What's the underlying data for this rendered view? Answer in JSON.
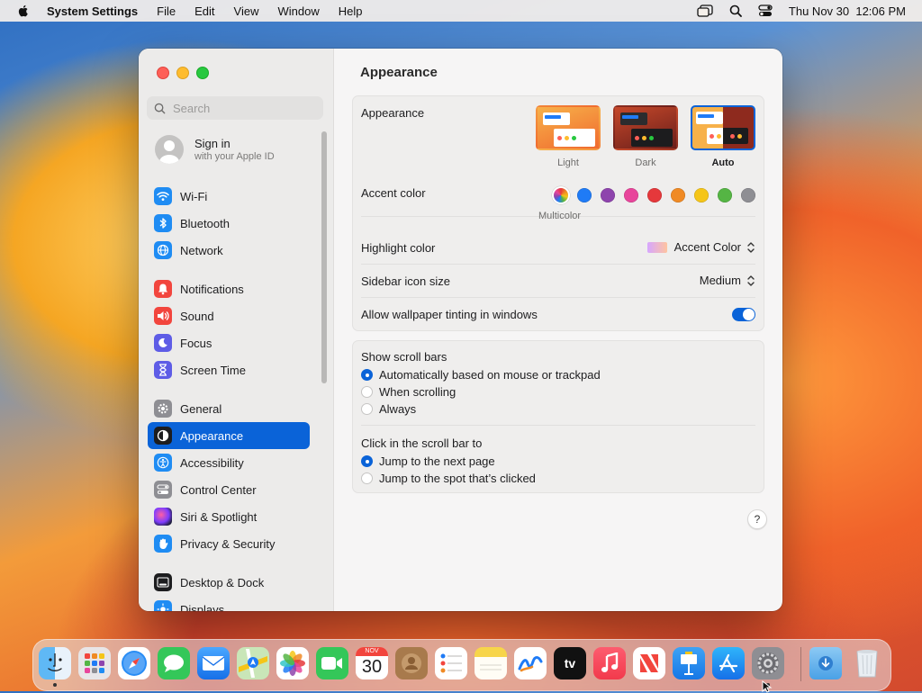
{
  "menubar": {
    "app_name": "System Settings",
    "menus": [
      "File",
      "Edit",
      "View",
      "Window",
      "Help"
    ],
    "clock": "Thu Nov 30  12:06 PM"
  },
  "sidebar": {
    "search_placeholder": "Search",
    "account": {
      "title": "Sign in",
      "subtitle": "with your Apple ID"
    },
    "items": [
      {
        "label": "Wi-Fi",
        "icon": "wifi-icon",
        "color": "#1f8cf3"
      },
      {
        "label": "Bluetooth",
        "icon": "bluetooth-icon",
        "color": "#1f8cf3"
      },
      {
        "label": "Network",
        "icon": "globe-icon",
        "color": "#1f8cf3"
      },
      {
        "label": "Notifications",
        "icon": "bell-icon",
        "color": "#f2453d"
      },
      {
        "label": "Sound",
        "icon": "speaker-icon",
        "color": "#f2453d"
      },
      {
        "label": "Focus",
        "icon": "moon-icon",
        "color": "#5e5ce6"
      },
      {
        "label": "Screen Time",
        "icon": "hourglass-icon",
        "color": "#5e5ce6"
      },
      {
        "label": "General",
        "icon": "gear-icon",
        "color": "#8e8e93"
      },
      {
        "label": "Appearance",
        "icon": "appearance-icon",
        "color": "#1d1d1f",
        "selected": true
      },
      {
        "label": "Accessibility",
        "icon": "accessibility-icon",
        "color": "#1f8cf3"
      },
      {
        "label": "Control Center",
        "icon": "control-center-icon",
        "color": "#8e8e93"
      },
      {
        "label": "Siri & Spotlight",
        "icon": "siri-icon",
        "color": "#8e44ad"
      },
      {
        "label": "Privacy & Security",
        "icon": "hand-icon",
        "color": "#1f8cf3"
      },
      {
        "label": "Desktop & Dock",
        "icon": "dock-icon",
        "color": "#1d1d1f"
      },
      {
        "label": "Displays",
        "icon": "sun-icon",
        "color": "#1f8cf3"
      }
    ]
  },
  "main": {
    "title": "Appearance",
    "appearance": {
      "label": "Appearance",
      "options": [
        {
          "label": "Light",
          "selected": false
        },
        {
          "label": "Dark",
          "selected": false
        },
        {
          "label": "Auto",
          "selected": true
        }
      ]
    },
    "accent": {
      "label": "Accent color",
      "caption": "Multicolor",
      "colors": [
        "multicolor",
        "#1f7bf6",
        "#8e44ad",
        "#e8459b",
        "#e5383b",
        "#f08a24",
        "#f5c518",
        "#55b544",
        "#8e8e93"
      ],
      "selected": "multicolor"
    },
    "highlight": {
      "label": "Highlight color",
      "value": "Accent Color"
    },
    "icon_size": {
      "label": "Sidebar icon size",
      "value": "Medium"
    },
    "tinting": {
      "label": "Allow wallpaper tinting in windows",
      "on": true
    },
    "scroll_bars": {
      "label": "Show scroll bars",
      "options": [
        {
          "label": "Automatically based on mouse or trackpad",
          "selected": true
        },
        {
          "label": "When scrolling",
          "selected": false
        },
        {
          "label": "Always",
          "selected": false
        }
      ]
    },
    "click_scroll": {
      "label": "Click in the scroll bar to",
      "options": [
        {
          "label": "Jump to the next page",
          "selected": true
        },
        {
          "label": "Jump to the spot that’s clicked",
          "selected": false
        }
      ]
    },
    "help_label": "?"
  },
  "dock": {
    "apps": [
      "Finder",
      "Launchpad",
      "Safari",
      "Messages",
      "Mail",
      "Maps",
      "Photos",
      "FaceTime",
      "Calendar",
      "Contacts",
      "Reminders",
      "Notes",
      "Freeform",
      "TV",
      "Music",
      "News",
      "Keynote",
      "App Store",
      "System Settings",
      "Downloads",
      "Trash"
    ],
    "calendar_month": "NOV",
    "calendar_day": "30",
    "tv_label": "tv"
  }
}
